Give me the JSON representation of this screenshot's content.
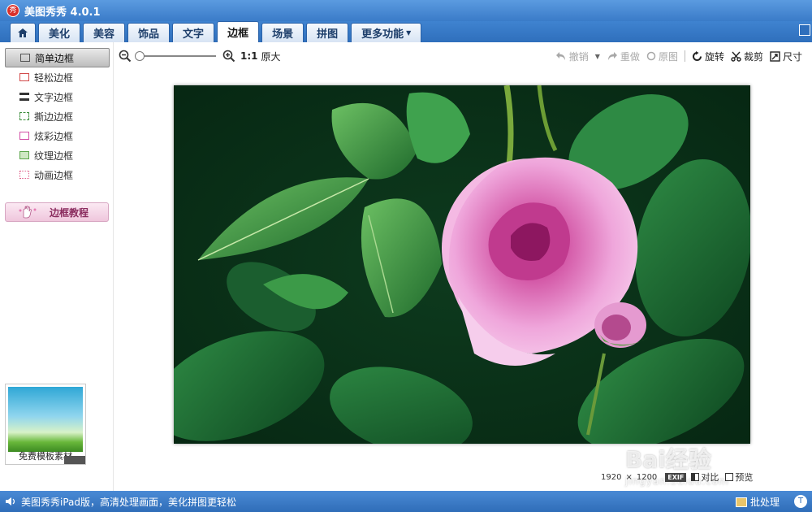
{
  "app": {
    "logo_text": "秀",
    "title": "美图秀秀 4.0.1"
  },
  "tabs": [
    {
      "label": "美化"
    },
    {
      "label": "美容"
    },
    {
      "label": "饰品"
    },
    {
      "label": "文字"
    },
    {
      "label": "边框"
    },
    {
      "label": "场景"
    },
    {
      "label": "拼图"
    },
    {
      "label": "更多功能"
    }
  ],
  "sidebar": {
    "items": [
      {
        "label": "简单边框",
        "color": "#444444"
      },
      {
        "label": "轻松边框",
        "color": "#d24a4a"
      },
      {
        "label": "文字边框",
        "color": "#333333"
      },
      {
        "label": "撕边边框",
        "color": "#3f8f3f"
      },
      {
        "label": "炫彩边框",
        "color": "#d24fa6"
      },
      {
        "label": "纹理边框",
        "color": "#5aa54a"
      },
      {
        "label": "动画边框",
        "color": "#e0608a"
      }
    ],
    "tutorial_label": "边框教程",
    "free_template_label": "免费模板素材"
  },
  "toolbar": {
    "one_to_one": "1:1",
    "original_size": "原大",
    "undo": "撤销",
    "redo": "重做",
    "original": "原图",
    "rotate": "旋转",
    "crop": "裁剪",
    "resize": "尺寸"
  },
  "image_info": {
    "width": "1920",
    "times": "×",
    "height": "1200",
    "exif": "EXIF",
    "compare": "对比",
    "preview": "预览"
  },
  "watermark": {
    "main": "Bai经验",
    "sub": "jingyan.baidu.com"
  },
  "status": {
    "message": "美图秀秀iPad版，高清处理画面，美化拼图更轻松",
    "batch": "批处理",
    "right_glyph": "T"
  },
  "colors": {
    "accent": "#3a7bc8",
    "tutorial": "#8a2b5e"
  }
}
